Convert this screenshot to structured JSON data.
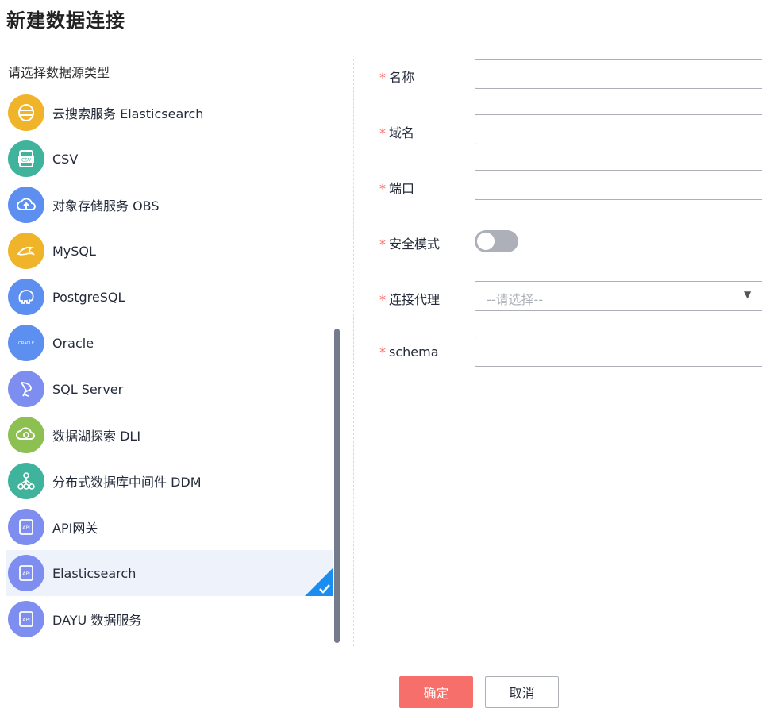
{
  "dialog": {
    "title": "新建数据连接"
  },
  "left": {
    "subhead": "请选择数据源类型",
    "items": [
      {
        "label": "云搜索服务 Elasticsearch",
        "icon": "elasticsearch-service-icon",
        "color": "#f0b42a"
      },
      {
        "label": "CSV",
        "icon": "csv-file-icon",
        "color": "#3fb39c"
      },
      {
        "label": "对象存储服务 OBS",
        "icon": "cloud-storage-icon",
        "color": "#5c8ff0"
      },
      {
        "label": "MySQL",
        "icon": "mysql-dolphin-icon",
        "color": "#f0b42a"
      },
      {
        "label": "PostgreSQL",
        "icon": "postgresql-elephant-icon",
        "color": "#5c8ff0"
      },
      {
        "label": "Oracle",
        "icon": "oracle-icon",
        "icon_text": "ORACLE",
        "color": "#5c8ff0"
      },
      {
        "label": "SQL Server",
        "icon": "sql-server-icon",
        "color": "#7d8ef0"
      },
      {
        "label": "数据湖探索 DLI",
        "icon": "data-lake-icon",
        "color": "#8cc152"
      },
      {
        "label": "分布式数据库中间件 DDM",
        "icon": "distributed-db-icon",
        "color": "#3fb39c"
      },
      {
        "label": "API网关",
        "icon": "api-gateway-icon",
        "icon_text": "API",
        "color": "#7d8ef0"
      },
      {
        "label": "Elasticsearch",
        "icon": "elasticsearch-api-icon",
        "icon_text": "API",
        "color": "#7d8ef0",
        "selected": true
      },
      {
        "label": "DAYU 数据服务",
        "icon": "dayu-api-icon",
        "icon_text": "API",
        "color": "#7d8ef0"
      }
    ]
  },
  "form": {
    "required_mark": "*",
    "name_label": "名称",
    "domain_label": "域名",
    "port_label": "端口",
    "secure_mode_label": "安全模式",
    "secure_mode_on": false,
    "proxy_label": "连接代理",
    "proxy_placeholder": "--请选择--",
    "schema_label": "schema"
  },
  "buttons": {
    "ok": "确定",
    "cancel": "取消"
  },
  "colors": {
    "accent": "#f66f6a",
    "selected_bg": "#eef3fb",
    "check": "#1a8ef0"
  }
}
